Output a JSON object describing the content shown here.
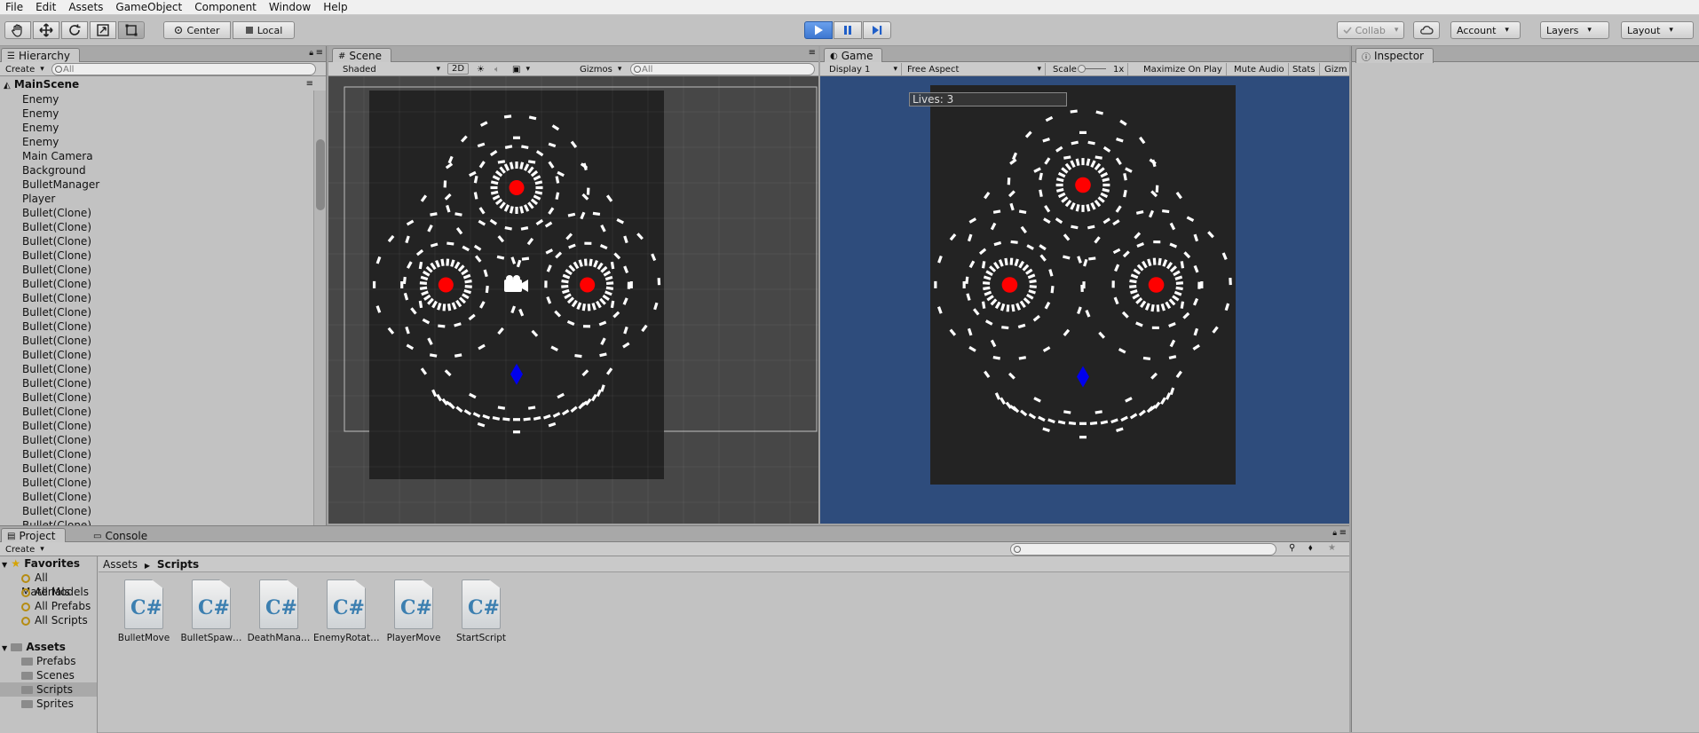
{
  "menu": [
    "File",
    "Edit",
    "Assets",
    "GameObject",
    "Component",
    "Window",
    "Help"
  ],
  "toolbar": {
    "pivot": "Center",
    "space": "Local",
    "collab": "Collab",
    "account": "Account",
    "layers": "Layers",
    "layout": "Layout"
  },
  "hierarchy": {
    "tab": "Hierarchy",
    "create": "Create",
    "search_placeholder": "All",
    "scene": "MainScene",
    "items": [
      "Enemy",
      "Enemy",
      "Enemy",
      "Enemy",
      "Main Camera",
      "Background",
      "BulletManager",
      "Player",
      "Bullet(Clone)",
      "Bullet(Clone)",
      "Bullet(Clone)",
      "Bullet(Clone)",
      "Bullet(Clone)",
      "Bullet(Clone)",
      "Bullet(Clone)",
      "Bullet(Clone)",
      "Bullet(Clone)",
      "Bullet(Clone)",
      "Bullet(Clone)",
      "Bullet(Clone)",
      "Bullet(Clone)",
      "Bullet(Clone)",
      "Bullet(Clone)",
      "Bullet(Clone)",
      "Bullet(Clone)",
      "Bullet(Clone)",
      "Bullet(Clone)",
      "Bullet(Clone)",
      "Bullet(Clone)",
      "Bullet(Clone)",
      "Bullet(Clone)"
    ]
  },
  "scene": {
    "tab": "Scene",
    "shading": "Shaded",
    "mode2d": "2D",
    "gizmos": "Gizmos",
    "search_placeholder": "All"
  },
  "game": {
    "tab": "Game",
    "display": "Display 1",
    "aspect": "Free Aspect",
    "scale_label": "Scale",
    "scale_value": "1x",
    "maximize": "Maximize On Play",
    "mute": "Mute Audio",
    "stats": "Stats",
    "gizmos": "Gizm",
    "lives": "Lives: 3"
  },
  "inspector": {
    "tab": "Inspector"
  },
  "bottom": {
    "project_tab": "Project",
    "console_tab": "Console",
    "create": "Create",
    "favorites_label": "Favorites",
    "favorites": [
      "All Materials",
      "All Models",
      "All Prefabs",
      "All Scripts"
    ],
    "assets_label": "Assets",
    "folders": [
      "Prefabs",
      "Scenes",
      "Scripts",
      "Sprites"
    ],
    "selected_folder": "Scripts",
    "breadcrumb": [
      "Assets",
      "Scripts"
    ],
    "files": [
      "BulletMove",
      "BulletSpaw…",
      "DeathMana…",
      "EnemyRotat…",
      "PlayerMove",
      "StartScript"
    ]
  },
  "colors": {
    "enemy": "#ff0000",
    "player": "#0000ee",
    "game_bg": "#2e4c7c",
    "scene_bg": "#474747",
    "playfield": "#232323",
    "play_button": "#3d77d1"
  },
  "icons": {
    "hand_tool": "hand-icon",
    "move_tool": "move-icon",
    "rotate_tool": "rotate-icon",
    "scale_tool": "scale-icon",
    "rect_tool": "rect-tool-icon",
    "play": "play-icon",
    "pause": "pause-icon",
    "step": "step-icon",
    "cloud": "cloud-icon",
    "camera": "camera-gizmo-icon",
    "script": "csharp-script-icon",
    "lock": "lock-icon"
  }
}
